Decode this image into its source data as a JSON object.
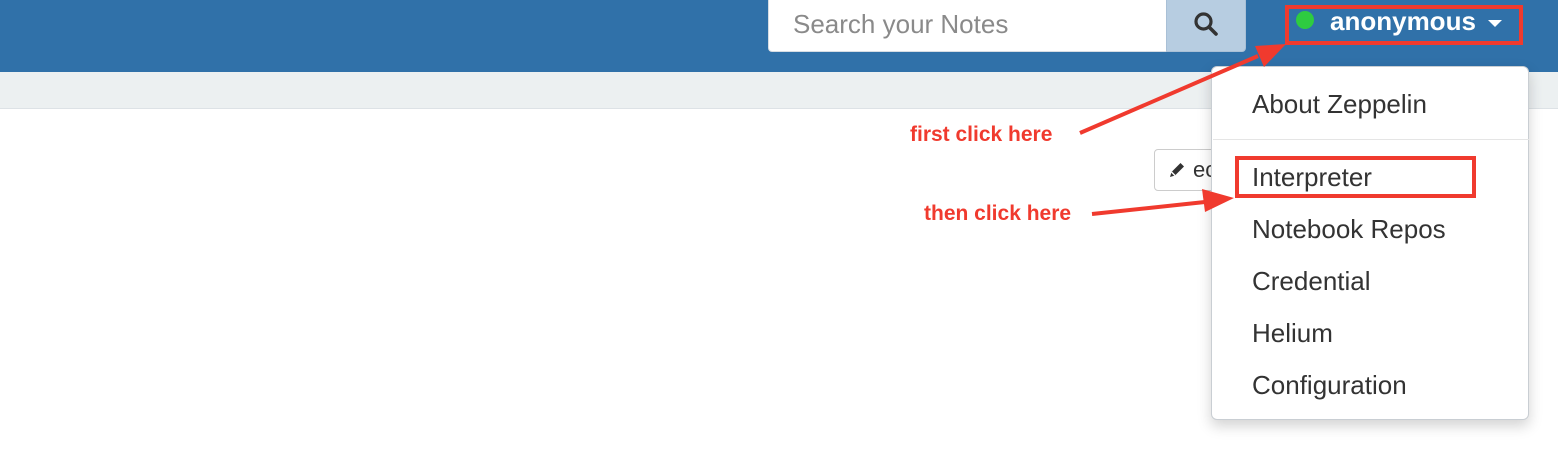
{
  "header": {
    "search": {
      "placeholder": "Search your Notes",
      "value": ""
    },
    "search_button_icon": "search-icon",
    "user": {
      "name": "anonymous",
      "status_color": "#2ecc40"
    }
  },
  "toolbar": {
    "edit_label": "ec",
    "edit_icon": "pencil-icon"
  },
  "dropdown": {
    "items": [
      {
        "label": "About Zeppelin"
      },
      {
        "label": "Interpreter"
      },
      {
        "label": "Notebook Repos"
      },
      {
        "label": "Credential"
      },
      {
        "label": "Helium"
      },
      {
        "label": "Configuration"
      }
    ]
  },
  "annotations": {
    "first": "first click here",
    "second": "then click here",
    "color": "#f03a2e"
  },
  "colors": {
    "navbar": "#3071a9",
    "page_background": "#ecf0f1"
  }
}
